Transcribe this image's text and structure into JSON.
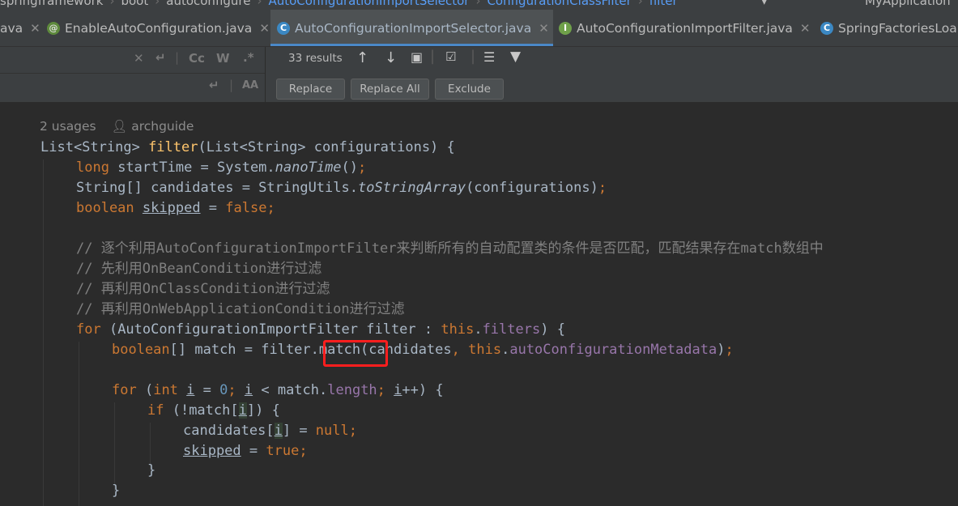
{
  "breadcrumb": {
    "items": [
      "springframework",
      "boot",
      "autoconfigure",
      "AutoConfigurationImportSelector",
      "ConfigurationClassFilter",
      "filter"
    ],
    "project": "MyApplication"
  },
  "tabs": [
    {
      "label": "ava",
      "icon": "none"
    },
    {
      "label": "EnableAutoConfiguration.java",
      "icon": "annotation-icon",
      "glyph": "@"
    },
    {
      "label": "AutoConfigurationImportSelector.java",
      "icon": "class-icon",
      "glyph": "C",
      "active": true
    },
    {
      "label": "AutoConfigurationImportFilter.java",
      "icon": "interface-icon",
      "glyph": "I"
    },
    {
      "label": "SpringFactoriesLoa",
      "icon": "class-icon",
      "glyph": "C"
    }
  ],
  "find": {
    "results": "33 results",
    "case_toggle": "Cc",
    "words_toggle": "W",
    "regex_toggle": ".*",
    "replace_label": "Replace",
    "replace_all_label": "Replace All",
    "exclude_label": "Exclude"
  },
  "code": {
    "usages": "2 usages",
    "author": "archguide",
    "l1": {
      "type": "List<String> ",
      "fn": "filter",
      "rest": "(List<String> configurations) {"
    },
    "l2": {
      "kw": "long",
      "a": " startTime = System.",
      "m": "nanoTime",
      "b": "()",
      "semi": ";"
    },
    "l3": {
      "a": "String[] candidates = StringUtils.",
      "m": "toStringArray",
      "b": "(configurations)",
      "semi": ";"
    },
    "l4": {
      "kw": "boolean",
      "sp": " ",
      "v": "skipped",
      "eq": " = ",
      "val": "false",
      "semi": ";"
    },
    "c1": "// 逐个利用AutoConfigurationImportFilter来判断所有的自动配置类的条件是否匹配，匹配结果存在match数组中",
    "c2": "// 先利用OnBeanCondition进行过滤",
    "c3": "// 再利用OnClassCondition进行过滤",
    "c4": "// 再利用OnWebApplicationCondition进行过滤",
    "l5": {
      "kw": "for",
      "a": " (AutoConfigurationImportFilter filter : ",
      "th": "this",
      "dot": ".",
      "f": "filters",
      "b": ") {"
    },
    "l6": {
      "kw": "boolean",
      "a": "[] match = filter.match(candidates",
      "comma": ", ",
      "th": "this",
      "dot": ".",
      "f": "autoConfigurationMetadata",
      "b": ")",
      "semi": ";"
    },
    "l7": {
      "kw": "for",
      "a": " (",
      "kw2": "int",
      "sp": " ",
      "i": "i",
      "eq": " = ",
      "n": "0",
      "s1": "; ",
      "i2": "i",
      "lt": " < match.",
      "len": "length",
      "s2": "; ",
      "i3": "i",
      "pp": "++) {"
    },
    "l8": {
      "kw": "if",
      "a": " (!match[",
      "i": "i",
      "b": "]) {"
    },
    "l9": {
      "a": "candidates[",
      "i": "i",
      "b": "] = ",
      "v": "null",
      "semi": ";"
    },
    "l10": {
      "v": "skipped",
      "eq": " = ",
      "val": "true",
      "semi": ";"
    },
    "l11": "}",
    "l12": "}"
  },
  "colors": {
    "keyword": "#cc7832",
    "function": "#ffc66d",
    "field": "#9876aa",
    "comment": "#808080",
    "number": "#6897bb",
    "highlight": "#ff1e1e"
  }
}
